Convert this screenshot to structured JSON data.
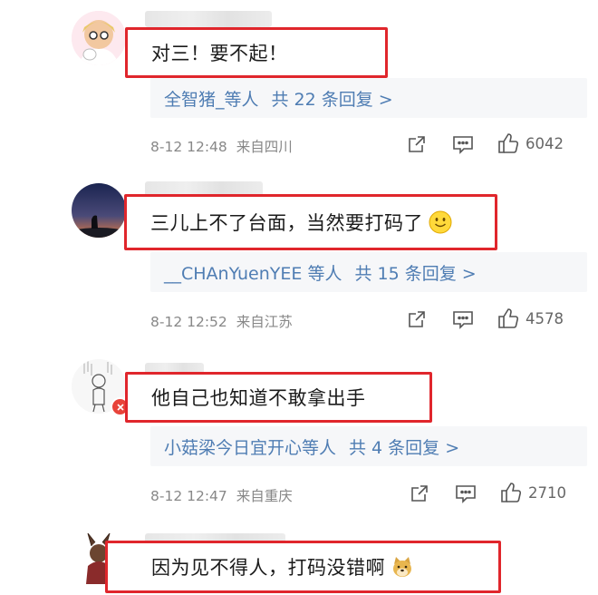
{
  "comments": [
    {
      "text": "对三！要不起！",
      "reply_users": "全智猪_等人",
      "reply_count": "共 22 条回复 >",
      "time": "8-12 12:48",
      "location": "来自四川",
      "likes": "6042"
    },
    {
      "text": "三儿上不了台面，当然要打码了",
      "reply_users": "__CHAnYuenYEE 等人",
      "reply_count": "共 15 条回复 >",
      "time": "8-12 12:52",
      "location": "来自江苏",
      "likes": "4578"
    },
    {
      "text": "他自己也知道不敢拿出手",
      "reply_users": "小菇梁今日宜开心等人",
      "reply_count": "共 4 条回复 >",
      "time": "8-12 12:47",
      "location": "来自重庆",
      "likes": "2710"
    },
    {
      "text": "因为见不得人，打码没错啊"
    }
  ],
  "colors": {
    "highlight_border": "#e0262c",
    "link": "#4f7db3",
    "meta": "#888888"
  },
  "icons": {
    "share": "share-icon",
    "comment": "comment-icon",
    "like": "thumbs-up-icon",
    "smile_emoji": "smile-emoji",
    "doge_emoji": "doge-emoji"
  }
}
